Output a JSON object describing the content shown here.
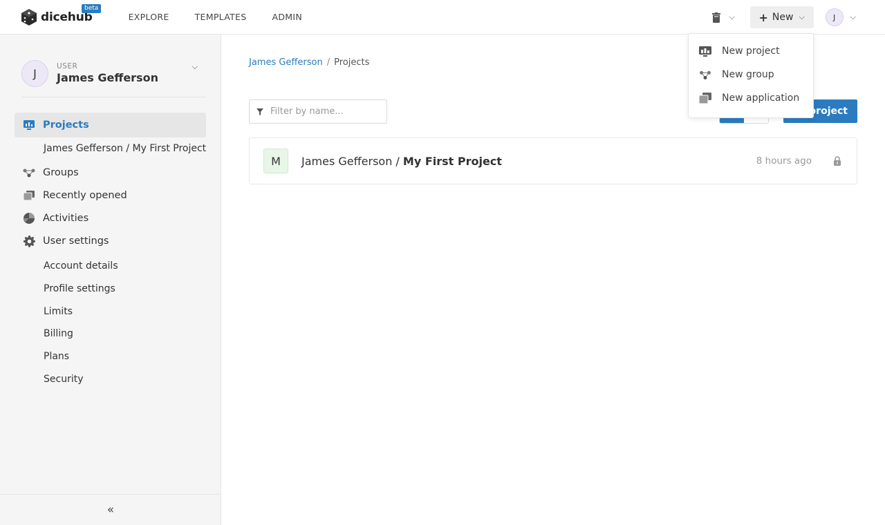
{
  "header": {
    "logo_text": "dicehub",
    "beta_badge": "beta",
    "nav": [
      "EXPLORE",
      "TEMPLATES",
      "ADMIN"
    ],
    "new_label": "New",
    "user_initial": "J"
  },
  "new_menu": {
    "items": [
      {
        "label": "New project",
        "icon": "project-icon"
      },
      {
        "label": "New group",
        "icon": "group-icon"
      },
      {
        "label": "New application",
        "icon": "application-icon"
      }
    ]
  },
  "sidebar": {
    "user_initial": "J",
    "user_role": "USER",
    "user_name": "James Gefferson",
    "items": [
      {
        "label": "Projects",
        "icon": "projects-icon",
        "active": true
      },
      {
        "label": "James Gefferson / My First Project"
      },
      {
        "label": "Groups",
        "icon": "groups-icon"
      },
      {
        "label": "Recently opened",
        "icon": "recently-opened-icon"
      },
      {
        "label": "Activities",
        "icon": "activities-icon"
      },
      {
        "label": "User settings",
        "icon": "gear-icon"
      }
    ],
    "settings_items": [
      "Account details",
      "Profile settings",
      "Limits",
      "Billing",
      "Plans",
      "Security"
    ],
    "collapse_glyph": "«"
  },
  "main": {
    "breadcrumb": {
      "user": "James Gefferson",
      "separator": "/",
      "page": "Projects"
    },
    "filter_placeholder": "Filter by name...",
    "create_button_visible_text": "project",
    "project": {
      "initial": "M",
      "owner": "James Gefferson",
      "separator": " / ",
      "name": "My First Project",
      "updated": "8 hours ago"
    }
  },
  "colors": {
    "accent": "#2a7bbf",
    "sidebar_bg": "#f5f5f5",
    "project_avatar_bg": "#e8f6e8"
  }
}
